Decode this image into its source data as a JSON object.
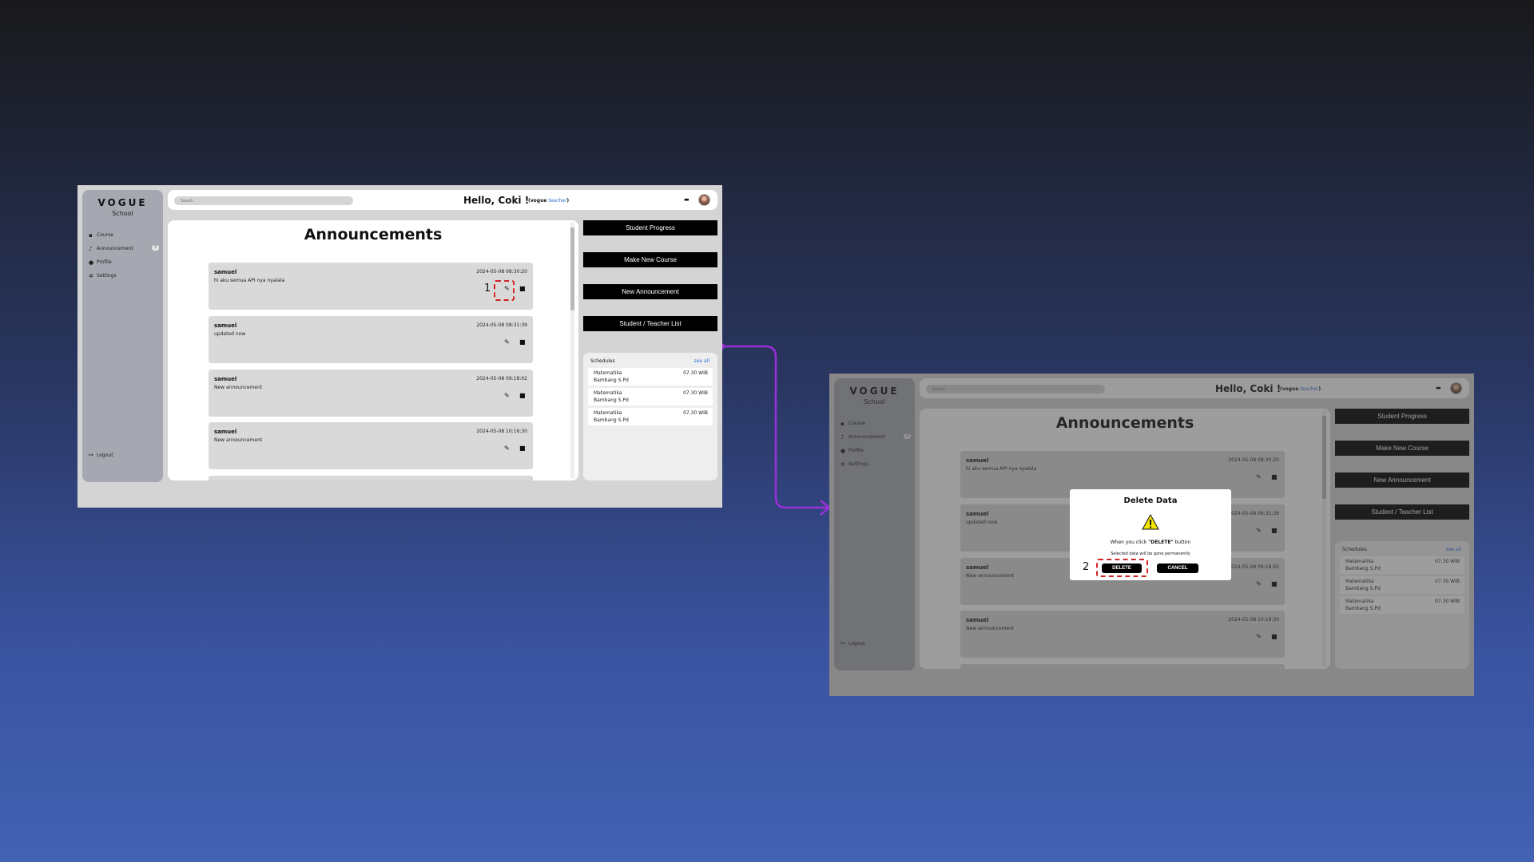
{
  "app": {
    "logo": "VOGUE",
    "logo_sub": "School",
    "nav": [
      {
        "label": "Course",
        "icon": "book-icon"
      },
      {
        "label": "Announcement",
        "icon": "bell-icon",
        "badge": "3"
      },
      {
        "label": "Profile",
        "icon": "user-icon"
      },
      {
        "label": "Settings",
        "icon": "gear-icon"
      }
    ],
    "logout": "Logout",
    "search_placeholder": "Search",
    "greeting": "Hello, Coki !",
    "role_open": "(vogue",
    "role_teacher": "teacher",
    "role_close": ")",
    "page_title": "Announcements",
    "announcements": [
      {
        "name": "samuel",
        "message": "hi aku semua API nya nyalala",
        "date": "2024-05-08 08:30:20"
      },
      {
        "name": "samuel",
        "message": "updated now",
        "date": "2024-05-08 08:31:39"
      },
      {
        "name": "samuel",
        "message": "New announcement",
        "date": "2024-05-08 09:18:02"
      },
      {
        "name": "samuel",
        "message": "New announcement",
        "date": "2024-05-08 10:16:30"
      }
    ],
    "actions": [
      "Student Progress",
      "Make New Course",
      "New Announcement",
      "Student / Teacher List"
    ],
    "schedules_title": "Schedules",
    "see_all": "see all",
    "schedules": [
      {
        "subject": "Matematika",
        "teacher": "Bambang S.Pd",
        "time": "07.30 WIB"
      },
      {
        "subject": "Matematika",
        "teacher": "Bambang S.Pd",
        "time": "07.30 WIB"
      },
      {
        "subject": "Matematika",
        "teacher": "Bambang S.Pd",
        "time": "07.30 WIB"
      }
    ]
  },
  "dialog": {
    "title": "Delete Data",
    "line1_pre": "When you click ",
    "line1_bold": "\"DELETE\"",
    "line1_post": " button",
    "line2": "Selected data will be gone permanently",
    "delete_label": "DELETE",
    "cancel_label": "CANCEL"
  },
  "annotations": {
    "step1": "1",
    "step2": "2",
    "mark_color": "#d42222",
    "arrow_color": "#9b2fd8"
  },
  "colors": {
    "accent_link": "#2d6fd8",
    "sidebar": "#a5a8b0",
    "button": "#000000"
  }
}
